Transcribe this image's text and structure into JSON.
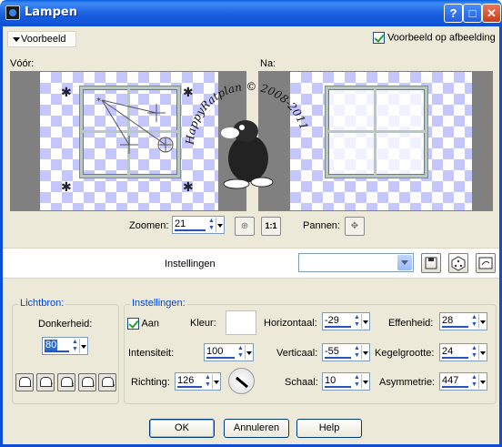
{
  "window": {
    "title": "Lampen"
  },
  "preview": {
    "toggle_label": "Voorbeeld",
    "on_image_label": "Voorbeeld op afbeelding",
    "on_image_checked": true,
    "before_label": "Vóór:",
    "after_label": "Na:"
  },
  "zoom": {
    "label": "Zoomen:",
    "value": "21",
    "pan_label": "Pannen:"
  },
  "settings_bar": {
    "label": "Instellingen",
    "preset_value": ""
  },
  "light_source": {
    "group_title": "Lichtbron:",
    "darkness_label": "Donkerheid:",
    "darkness_value": "80",
    "lamp_buttons": [
      "1",
      "2",
      "3",
      "4",
      "5"
    ]
  },
  "settings": {
    "group_title": "Instellingen:",
    "on_label": "Aan",
    "on_checked": true,
    "color_label": "Kleur:",
    "color_value": "#ffffff",
    "intensity_label": "Intensiteit:",
    "intensity_value": "100",
    "direction_label": "Richting:",
    "direction_value": "126",
    "horizontal_label": "Horizontaal:",
    "horizontal_value": "-29",
    "vertical_label": "Verticaal:",
    "vertical_value": "-55",
    "scale_label": "Schaal:",
    "scale_value": "10",
    "sharpness_label": "Effenheid:",
    "sharpness_value": "28",
    "cone_label": "Kegelgrootte:",
    "cone_value": "24",
    "asymmetry_label": "Asymmetrie:",
    "asymmetry_value": "447"
  },
  "buttons": {
    "ok": "OK",
    "cancel": "Annuleren",
    "help": "Help"
  },
  "watermark": "HappyRatplan © 2008-2011",
  "colors": {
    "titlebar": "#0c4fd4",
    "accent_text": "#0046d5",
    "checker": "#c6c6ff"
  }
}
